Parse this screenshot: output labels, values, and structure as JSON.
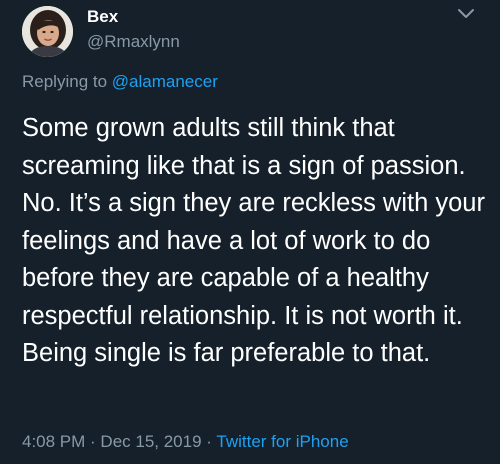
{
  "author": {
    "display_name": "Bex",
    "handle": "@Rmaxlynn"
  },
  "reply": {
    "prefix": "Replying to ",
    "mention": "@alamanecer"
  },
  "tweet": {
    "text": "Some grown adults still think that screaming like that is a sign of passion. No. It’s a sign they are reckless with your feelings and have a lot of work to do before they are capable of a healthy respectful relationship. It is not worth it. Being single is far preferable to that."
  },
  "meta": {
    "time": "4:08 PM",
    "separator": " · ",
    "date": "Dec 15, 2019",
    "separator2": " · ",
    "source": "Twitter for iPhone"
  },
  "colors": {
    "background": "#15202b",
    "primary_text": "#ffffff",
    "secondary_text": "#8899a6",
    "accent": "#1da1f2"
  },
  "icons": {
    "menu": "chevron-down-icon",
    "avatar": "profile-photo"
  }
}
